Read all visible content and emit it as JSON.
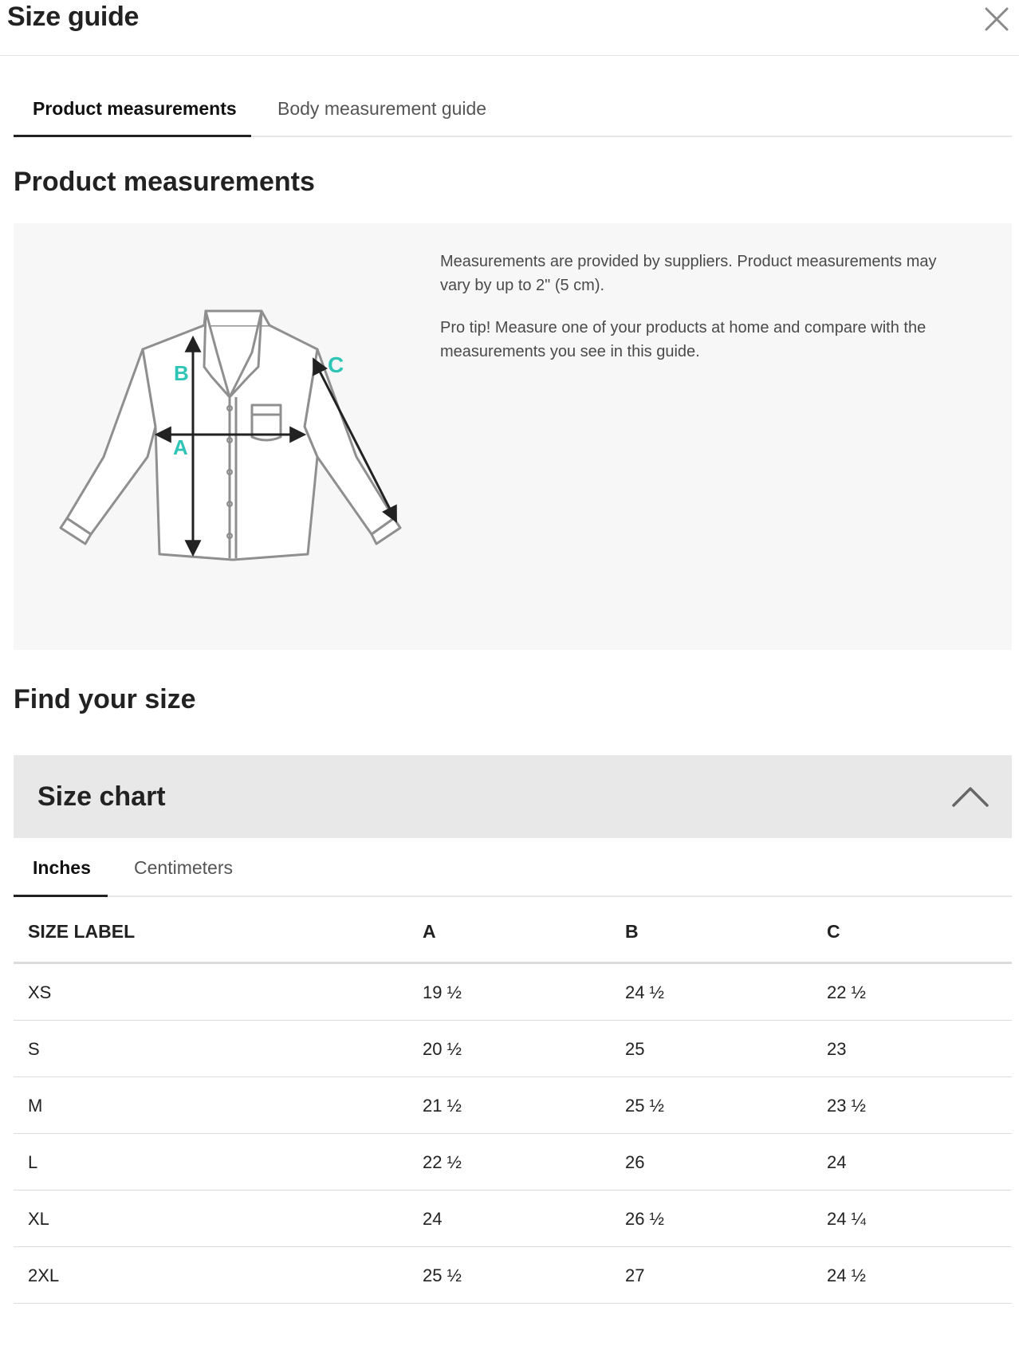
{
  "header": {
    "title": "Size guide",
    "close_icon": "close-icon"
  },
  "tabs": [
    {
      "label": "Product measurements",
      "active": true
    },
    {
      "label": "Body measurement guide",
      "active": false
    }
  ],
  "product_section": {
    "title": "Product measurements",
    "diagram_labels": {
      "a": "A",
      "b": "B",
      "c": "C"
    },
    "accent_color": "#2ec4b6",
    "notes": [
      "Measurements are provided by suppliers. Product measurements may vary by up to 2\" (5 cm).",
      "Pro tip! Measure one of your products at home and compare with the measurements you see in this guide."
    ]
  },
  "find_size": {
    "title": "Find your size"
  },
  "size_chart": {
    "title": "Size chart",
    "expanded": true,
    "toggle_icon": "chevron-up-icon",
    "unit_tabs": [
      {
        "label": "Inches",
        "active": true
      },
      {
        "label": "Centimeters",
        "active": false
      }
    ],
    "columns": [
      "SIZE LABEL",
      "A",
      "B",
      "C"
    ],
    "rows": [
      [
        "XS",
        "19 ½",
        "24 ½",
        "22 ½"
      ],
      [
        "S",
        "20 ½",
        "25",
        "23"
      ],
      [
        "M",
        "21 ½",
        "25 ½",
        "23 ½"
      ],
      [
        "L",
        "22 ½",
        "26",
        "24"
      ],
      [
        "XL",
        "24",
        "26 ½",
        "24 ¼"
      ],
      [
        "2XL",
        "25 ½",
        "27",
        "24 ½"
      ]
    ]
  }
}
